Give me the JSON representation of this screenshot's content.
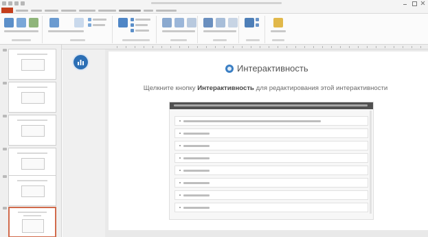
{
  "window": {
    "title": "",
    "qat": [
      "save",
      "undo",
      "redo",
      "customize"
    ],
    "controls": [
      "minimize",
      "maximize",
      "close"
    ]
  },
  "ribbon": {
    "file_tab": "",
    "tabs": [
      "",
      "",
      "",
      "",
      "",
      "",
      "",
      "",
      "",
      ""
    ],
    "active_tab_index": 6,
    "groups": [
      "",
      "",
      "",
      "",
      "",
      "",
      "",
      ""
    ]
  },
  "thumbnails": {
    "slide_count": 6,
    "selected_index": 5
  },
  "slide": {
    "heading_icon": "interactivity-icon",
    "heading": "Интерактивность",
    "subtitle_before": "Щелкните кнопку",
    "subtitle_bold": "Интерактивность",
    "subtitle_after": "для редактирования этой интерактивности"
  },
  "panel": {
    "header_text": "",
    "rows": [
      "",
      "",
      "",
      "",
      "",
      "",
      "",
      ""
    ]
  },
  "colors": {
    "accent_orange": "#c43e1c",
    "selected_thumb": "#d16a4b",
    "panel_header": "#515151",
    "round_icon": "#2c6fb5"
  }
}
